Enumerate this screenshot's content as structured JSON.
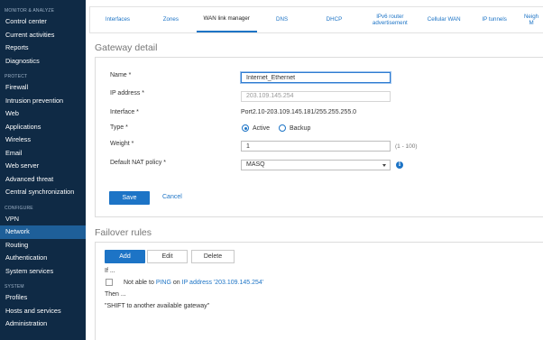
{
  "sidebar": {
    "sections": [
      {
        "title": "MONITOR & ANALYZE",
        "items": [
          "Control center",
          "Current activities",
          "Reports",
          "Diagnostics"
        ]
      },
      {
        "title": "PROTECT",
        "items": [
          "Firewall",
          "Intrusion prevention",
          "Web",
          "Applications",
          "Wireless",
          "Email",
          "Web server",
          "Advanced threat",
          "Central synchronization"
        ]
      },
      {
        "title": "CONFIGURE",
        "items": [
          "VPN",
          "Network",
          "Routing",
          "Authentication",
          "System services"
        ]
      },
      {
        "title": "SYSTEM",
        "items": [
          "Profiles",
          "Hosts and services",
          "Administration"
        ]
      }
    ],
    "active_item": "Network"
  },
  "tabs": [
    "Interfaces",
    "Zones",
    "WAN link manager",
    "DNS",
    "DHCP",
    "IPv6 router\nadvertisement",
    "Cellular WAN",
    "IP tunnels",
    "Neigh\nM"
  ],
  "active_tab": "WAN link manager",
  "gateway": {
    "title": "Gateway detail",
    "name_label": "Name *",
    "name_value": "Internet_Ethernet",
    "ip_label": "IP address *",
    "ip_value": "203.109.145.254",
    "interface_label": "Interface *",
    "interface_value": "Port2.10-203.109.145.181/255.255.255.0",
    "type_label": "Type *",
    "type_active": "Active",
    "type_backup": "Backup",
    "weight_label": "Weight *",
    "weight_value": "1",
    "weight_hint": "(1 - 100)",
    "nat_label": "Default NAT policy *",
    "nat_value": "MASQ",
    "save": "Save",
    "cancel": "Cancel"
  },
  "failover": {
    "title": "Failover rules",
    "add": "Add",
    "edit": "Edit",
    "delete": "Delete",
    "if_text": "If ...",
    "cond_pre": "Not able to ",
    "cond_proto": "PING",
    "cond_mid": " on ",
    "cond_ip": "IP address '203.109.145.254'",
    "then_text": "Then ...",
    "action_text": "\"SHIFT to another available gateway\""
  },
  "colors": {
    "sidebar_bg": "#0f2a45",
    "active_bg": "#1e5f99",
    "accent": "#1d74c6"
  }
}
